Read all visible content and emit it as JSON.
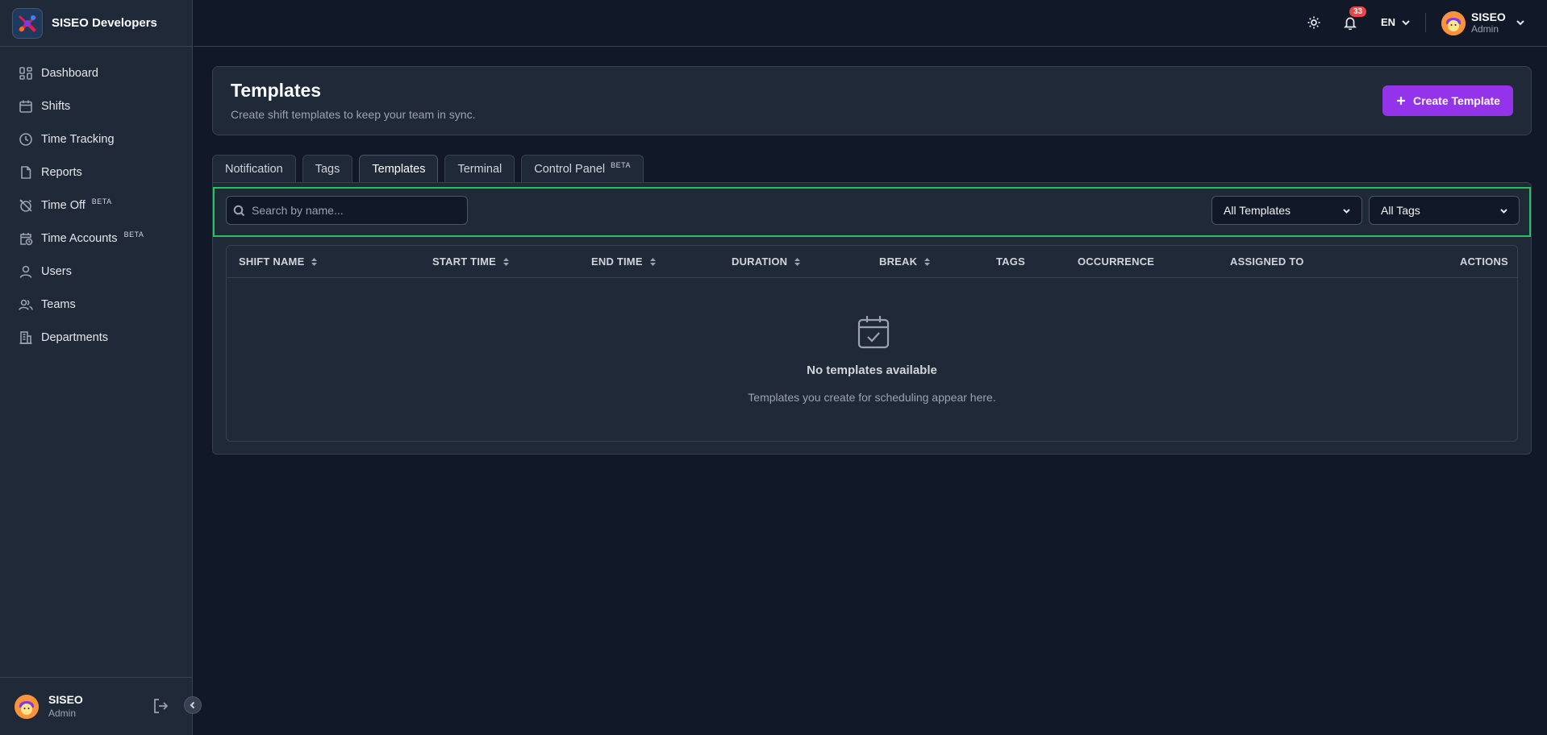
{
  "app": {
    "brand_name": "SISEO Developers"
  },
  "sidebar": {
    "items": [
      {
        "label": "Dashboard",
        "icon": "dashboard-icon",
        "beta": ""
      },
      {
        "label": "Shifts",
        "icon": "calendar-icon",
        "beta": ""
      },
      {
        "label": "Time Tracking",
        "icon": "clock-icon",
        "beta": ""
      },
      {
        "label": "Reports",
        "icon": "file-icon",
        "beta": ""
      },
      {
        "label": "Time Off",
        "icon": "alarm-off-icon",
        "beta": "BETA"
      },
      {
        "label": "Time Accounts",
        "icon": "calendar-clock-icon",
        "beta": "BETA"
      },
      {
        "label": "Users",
        "icon": "user-icon",
        "beta": ""
      },
      {
        "label": "Teams",
        "icon": "users-icon",
        "beta": ""
      },
      {
        "label": "Departments",
        "icon": "building-icon",
        "beta": ""
      }
    ],
    "footer": {
      "user_name": "SISEO",
      "user_role": "Admin"
    }
  },
  "topbar": {
    "notification_count": "33",
    "language": "EN",
    "user_name": "SISEO",
    "user_role": "Admin"
  },
  "page": {
    "title": "Templates",
    "subtitle": "Create shift templates to keep your team in sync.",
    "create_button": "Create Template"
  },
  "tabs": [
    {
      "label": "Notification",
      "beta": "",
      "active": false
    },
    {
      "label": "Tags",
      "beta": "",
      "active": false
    },
    {
      "label": "Templates",
      "beta": "",
      "active": true
    },
    {
      "label": "Terminal",
      "beta": "",
      "active": false
    },
    {
      "label": "Control Panel",
      "beta": "BETA",
      "active": false
    }
  ],
  "filters": {
    "search_placeholder": "Search by name...",
    "template_select": "All Templates",
    "tag_select": "All Tags"
  },
  "table": {
    "columns": [
      "SHIFT NAME",
      "START TIME",
      "END TIME",
      "DURATION",
      "BREAK",
      "TAGS",
      "OCCURRENCE",
      "ASSIGNED TO",
      "ACTIONS"
    ],
    "empty_title": "No templates available",
    "empty_subtitle": "Templates you create for scheduling appear here."
  },
  "colors": {
    "background": "#111827",
    "surface": "#1f2937",
    "accent": "#9333ea",
    "badge": "#ef4444",
    "highlight": "#22c55e"
  }
}
